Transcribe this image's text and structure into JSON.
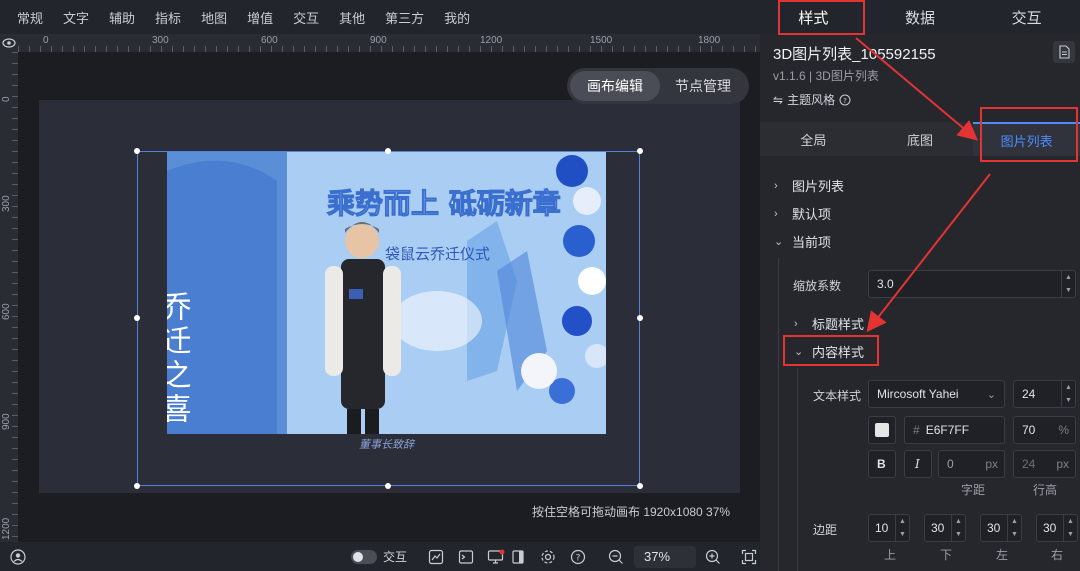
{
  "menu": [
    "常规",
    "文字",
    "辅助",
    "指标",
    "地图",
    "增值",
    "交互",
    "其他",
    "第三方",
    "我的"
  ],
  "ruler_top": [
    "0",
    "300",
    "600",
    "900",
    "1200",
    "1500",
    "1800"
  ],
  "ruler_left": [
    "0",
    "300",
    "600",
    "900",
    "1200"
  ],
  "view_toggle": {
    "canvas_edit": "画布编辑",
    "node_manage": "节点管理"
  },
  "photo": {
    "banner": "乘势而上 砥砺新章",
    "subtitle": "袋鼠云乔迁仪式",
    "side_text": "乔迁之喜"
  },
  "caption": "董事长致辞",
  "canvas_status": "按住空格可拖动画布   1920x1080 37%",
  "bottombar": {
    "interaction_label": "交互",
    "zoom": "37%"
  },
  "panel": {
    "tabs": [
      "样式",
      "数据",
      "交互"
    ],
    "component_title": "3D图片列表_105592155",
    "component_sub": "v1.1.6 | 3D图片列表",
    "theme_style": "主题风格",
    "sub_tabs": [
      "全局",
      "底图",
      "图片列表"
    ],
    "tree": {
      "image_list": "图片列表",
      "default_item": "默认项",
      "current_item": "当前项",
      "scale_label": "缩放系数",
      "scale_value": "3.0",
      "title_style": "标题样式",
      "content_style": "内容样式",
      "text_style_label": "文本样式",
      "font_family": "Mircosoft Yahei",
      "font_size": "24",
      "color_hex": "E6F7FF",
      "opacity": "70",
      "opacity_unit": "%",
      "bold": "B",
      "italic": "I",
      "letter_spacing": "0",
      "line_height": "24",
      "px": "px",
      "letter_spacing_label": "字距",
      "line_height_label": "行高",
      "margin_label": "边距",
      "margins": [
        "10",
        "30",
        "30",
        "30"
      ],
      "margin_captions": [
        "上",
        "下",
        "左",
        "右"
      ]
    }
  },
  "colors": {
    "accent": "#4d8dff",
    "highlight": "#e33333",
    "selection": "#5a7fd8"
  }
}
